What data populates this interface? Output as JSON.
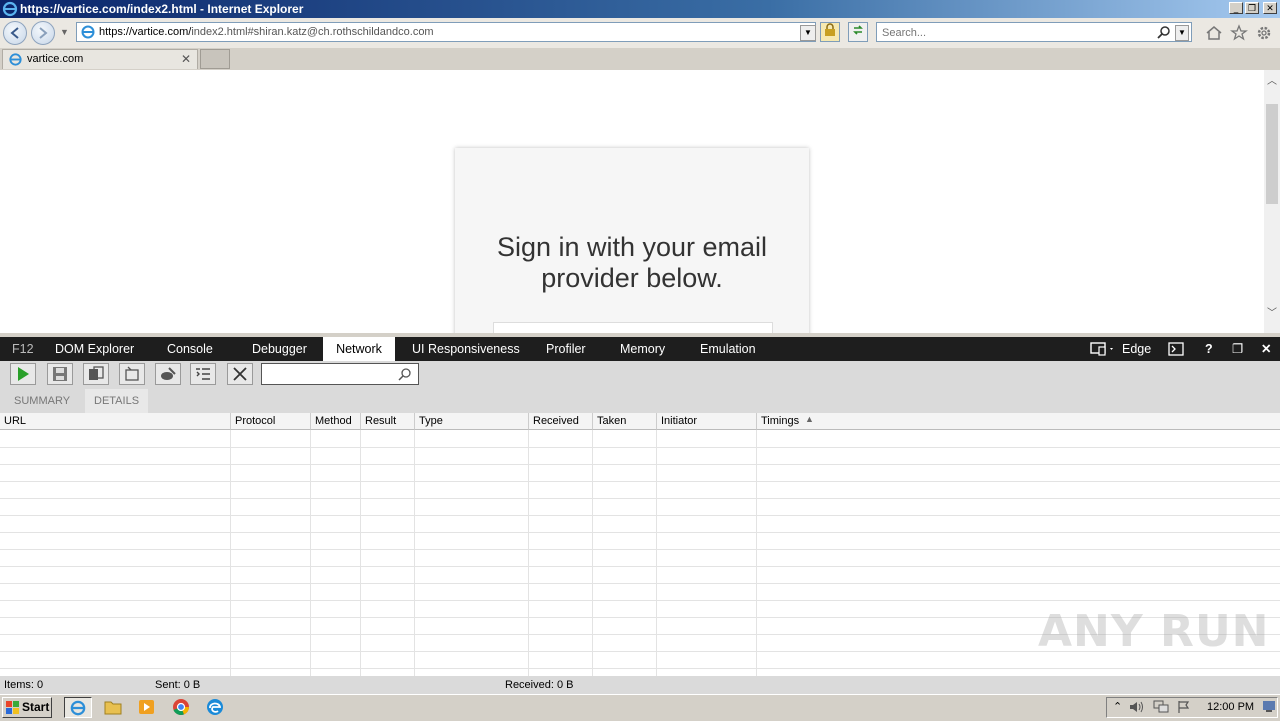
{
  "window": {
    "title": "https://vartice.com/index2.html - Internet Explorer",
    "controls": [
      "_",
      "❐",
      "✕"
    ]
  },
  "nav": {
    "address_host": "https://vartice.com/",
    "address_path": "index2.html#shiran.katz@ch.rothschildandco.com",
    "search_placeholder": "Search..."
  },
  "tabs": [
    {
      "label": "vartice.com",
      "close": "✕"
    }
  ],
  "page": {
    "heading": "Sign in with your email provider below."
  },
  "devtools": {
    "tabs": [
      "F12",
      "DOM Explorer",
      "Console",
      "Debugger",
      "Network",
      "UI Responsiveness",
      "Profiler",
      "Memory",
      "Emulation"
    ],
    "active_tab": "Network",
    "mode_label": "Edge",
    "right_icons": [
      "?",
      "❐",
      "✕"
    ],
    "subtabs": [
      "SUMMARY",
      "DETAILS"
    ],
    "columns": [
      "URL",
      "Protocol",
      "Method",
      "Result",
      "Type",
      "Received",
      "Taken",
      "Initiator",
      "Timings"
    ],
    "status": {
      "items": "Items: 0",
      "sent": "Sent: 0 B",
      "received": "Received: 0 B"
    }
  },
  "taskbar": {
    "start_label": "Start",
    "clock": "12:00 PM"
  },
  "watermark": "ANY RUN"
}
